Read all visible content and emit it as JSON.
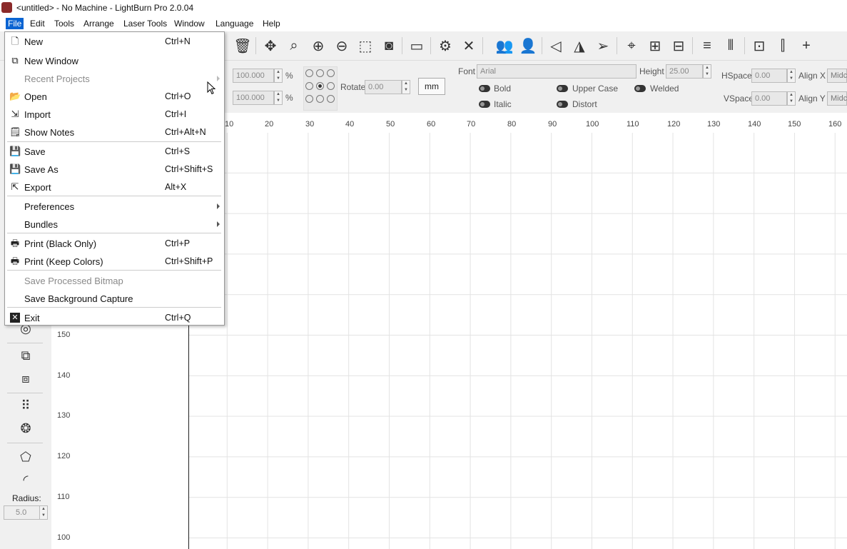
{
  "window": {
    "title": "<untitled> - No Machine - LightBurn Pro 2.0.04"
  },
  "menubar": {
    "items": [
      "File",
      "Edit",
      "Tools",
      "Arrange",
      "Laser Tools",
      "Window",
      "Language",
      "Help"
    ]
  },
  "toolbar": {
    "icons": [
      "trash-icon",
      "move-icon",
      "zoom-selection-icon",
      "zoom-in-icon",
      "zoom-out-icon",
      "select-frame-icon",
      "camera-icon",
      "monitor-icon",
      "machine-settings-icon",
      "tools-icon",
      "group-icon",
      "ungroup-icon",
      "flip-horizontal-icon",
      "mirror-icon",
      "send-icon",
      "target-icon",
      "align-icon",
      "distribute-icon",
      "align-top-icon",
      "align-middle-icon",
      "distribute-h-icon",
      "distribute-v-icon",
      "move-together-icon"
    ]
  },
  "props": {
    "scale_x": "100.000",
    "scale_y": "100.000",
    "percent": "%",
    "rotate_label": "Rotate",
    "rotate_value": "0.00",
    "unit_button": "mm",
    "font_label": "Font",
    "font_value": "Arial",
    "height_label": "Height",
    "height_value": "25.00",
    "hspace_label": "HSpace",
    "hspace_value": "0.00",
    "vspace_label": "VSpace",
    "vspace_value": "0.00",
    "alignx_label": "Align X",
    "alignx_value": "Midc",
    "aligny_label": "Align Y",
    "aligny_value": "Midc",
    "bold": "Bold",
    "italic": "Italic",
    "upper_case": "Upper Case",
    "distort": "Distort",
    "welded": "Welded"
  },
  "ruler_top": [
    "10",
    "20",
    "30",
    "40",
    "50",
    "60",
    "70",
    "80",
    "90",
    "100",
    "110",
    "120",
    "130",
    "140",
    "150",
    "160"
  ],
  "ruler_left": [
    "150",
    "140",
    "130",
    "120",
    "110",
    "100"
  ],
  "left_panel": {
    "radius_label": "Radius:",
    "radius_value": "5.0"
  },
  "file_menu": {
    "items": [
      {
        "label": "New",
        "shortcut": "Ctrl+N",
        "icon": "new-file-icon"
      },
      {
        "label": "New Window",
        "shortcut": "",
        "icon": "new-window-icon"
      },
      {
        "label": "Recent Projects",
        "shortcut": "",
        "disabled": true,
        "submenu": true
      },
      {
        "label": "Open",
        "shortcut": "Ctrl+O",
        "icon": "folder-open-icon"
      },
      {
        "label": "Import",
        "shortcut": "Ctrl+I",
        "icon": "import-icon"
      },
      {
        "label": "Show Notes",
        "shortcut": "Ctrl+Alt+N",
        "icon": "notes-icon"
      },
      {
        "label": "Save",
        "shortcut": "Ctrl+S",
        "icon": "save-icon"
      },
      {
        "label": "Save As",
        "shortcut": "Ctrl+Shift+S",
        "icon": "save-as-icon"
      },
      {
        "label": "Export",
        "shortcut": "Alt+X",
        "icon": "export-icon"
      },
      {
        "label": "Preferences",
        "shortcut": "",
        "submenu": true
      },
      {
        "label": "Bundles",
        "shortcut": "",
        "submenu": true
      },
      {
        "label": "Print (Black Only)",
        "shortcut": "Ctrl+P",
        "icon": "printer-icon"
      },
      {
        "label": "Print (Keep Colors)",
        "shortcut": "Ctrl+Shift+P",
        "icon": "printer-icon"
      },
      {
        "label": "Save Processed Bitmap",
        "shortcut": "",
        "disabled": true
      },
      {
        "label": "Save Background Capture",
        "shortcut": ""
      },
      {
        "label": "Exit",
        "shortcut": "Ctrl+Q",
        "icon": "exit-icon"
      }
    ]
  }
}
